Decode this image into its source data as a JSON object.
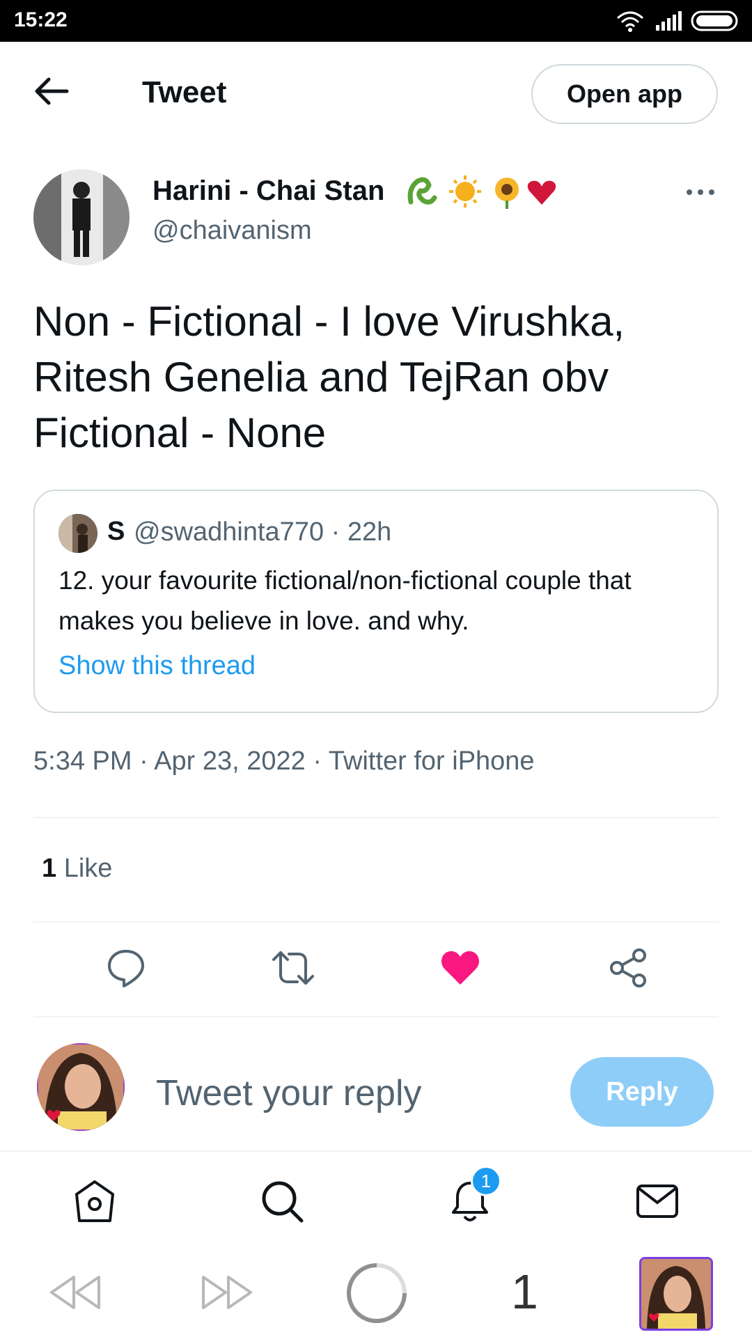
{
  "status_bar": {
    "time": "15:22"
  },
  "header": {
    "title": "Tweet",
    "open_app_label": "Open app"
  },
  "author": {
    "name": "Harini - Chai Stan",
    "handle": "@chaivanism",
    "name_emojis": [
      "🐍",
      "🌞",
      "🌻",
      "❤️"
    ]
  },
  "tweet": {
    "text": "Non - Fictional - I love Virushka,\nRitesh Genelia and TejRan obv\nFictional - None"
  },
  "quote": {
    "name": "S",
    "handle_time": "@swadhinta770 · 22h",
    "text": "12. your favourite fictional/non-fictional couple that makes you believe in love. and why.",
    "show_thread": "Show this thread"
  },
  "meta": {
    "timestamp": "5:34 PM · Apr 23, 2022 · Twitter for iPhone"
  },
  "likes": {
    "count": "1",
    "label": "Like"
  },
  "reply": {
    "placeholder": "Tweet your reply",
    "button_label": "Reply"
  },
  "bottom_nav": {
    "notification_badge": "1"
  },
  "browser": {
    "tab_count": "1"
  },
  "colors": {
    "accent": "#1d9bf0",
    "like": "#f91880",
    "reply_button": "#8ecdf8"
  }
}
